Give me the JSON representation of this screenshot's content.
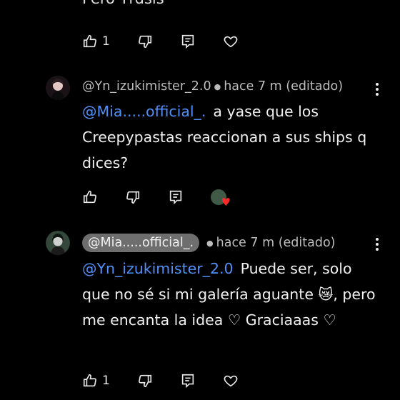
{
  "top_partial": {
    "text": "Pero Yrdsis",
    "like_count": "1"
  },
  "comment1": {
    "author": "@Yn_izukimister_2.0",
    "time": "hace 7 m (editado)",
    "mention": "@Mia.....official_.",
    "text": "a yase que los Creepypastas reaccionan a sus ships q dices?",
    "icons": [
      "thumbs-up-icon",
      "thumbs-down-icon",
      "reply-icon",
      "creator-heart-icon"
    ]
  },
  "comment2": {
    "author": "@Mia.....official_.",
    "time": "hace 7 m (editado)",
    "mention": "@Yn_izukimister_2.0",
    "text_a": "Puede ser, solo que no sé si mi galería aguante",
    "emoji": "😿",
    "text_b": ", pero me encanta la idea ♡ Graciaaas ♡",
    "like_count": "1"
  },
  "colors": {
    "background": "#000000",
    "mention": "#4f8ff7",
    "heart": "#ff2a2a",
    "chip": "#6e6e6e"
  }
}
